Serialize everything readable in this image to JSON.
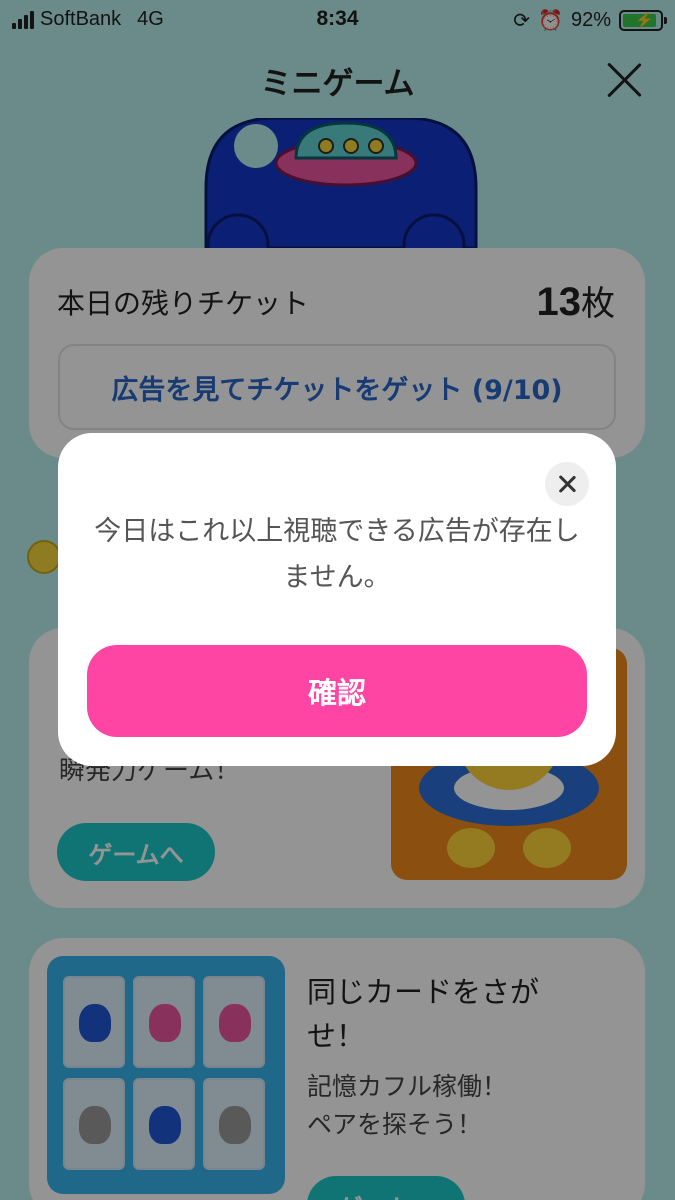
{
  "status_bar": {
    "carrier": "SoftBank",
    "network": "4G",
    "time": "8:34",
    "battery_percent": "92%",
    "battery_level": 0.92
  },
  "header": {
    "title": "ミニゲーム",
    "close_icon": "close-icon"
  },
  "ticket": {
    "label": "本日の残りチケット",
    "count": "13",
    "unit": "枚",
    "ad_button_label": "広告を見てチケットをゲット (9/10)"
  },
  "games": [
    {
      "description": "瞬発力ゲーム！",
      "button_label": "ゲームへ"
    },
    {
      "title": "同じカードをさが\nせ！",
      "description_line1": "記憶カフル稼働！",
      "description_line2": "ペアを探そう！",
      "button_label": "ゲームへ"
    }
  ],
  "modal": {
    "message": "今日はこれ以上視聴できる広告が存在しません。",
    "confirm_label": "確認"
  },
  "colors": {
    "background": "#b8eeee",
    "accent_pink": "#ff45a4",
    "accent_teal": "#1ec8c8",
    "link_blue": "#2a66c9"
  }
}
